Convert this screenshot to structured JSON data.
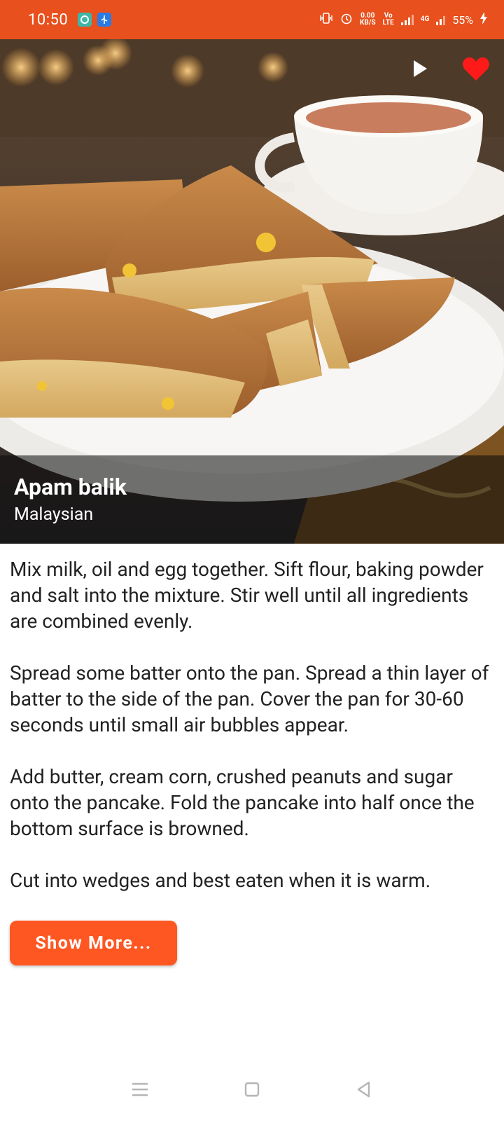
{
  "status_bar": {
    "time": "10:50",
    "app_icons": [
      "chat-bubble-icon",
      "usb-icon"
    ],
    "right_icons": [
      "vibrate-icon",
      "alarm-icon"
    ],
    "network_speed": "0.00\nKB/S",
    "volte": "Vo\nLTE",
    "mobile_data": "4G",
    "battery": "55%",
    "background_color": "#e8501d"
  },
  "hero": {
    "title": "Apam balik",
    "cuisine": "Malaysian",
    "play_icon": "play-icon",
    "favorite_icon": "heart-icon",
    "favorite_color": "#ff1a1a",
    "is_favorite": true
  },
  "instructions": {
    "steps": [
      "Mix milk, oil and egg together. Sift flour, baking powder and salt into the mixture. Stir well until all ingredients are combined evenly.",
      "Spread some batter onto the pan. Spread a thin layer of batter to the side of the pan. Cover the pan for 30-60 seconds until small air bubbles appear.",
      "Add butter, cream corn, crushed peanuts and sugar onto the pancake. Fold the pancake into half once the bottom surface is browned.",
      "Cut into wedges and best eaten when it is warm."
    ]
  },
  "show_more": {
    "label": "Show More...",
    "color": "#ff5722"
  },
  "nav_bar": {
    "icons": [
      "menu-icon",
      "home-icon",
      "back-icon"
    ]
  }
}
